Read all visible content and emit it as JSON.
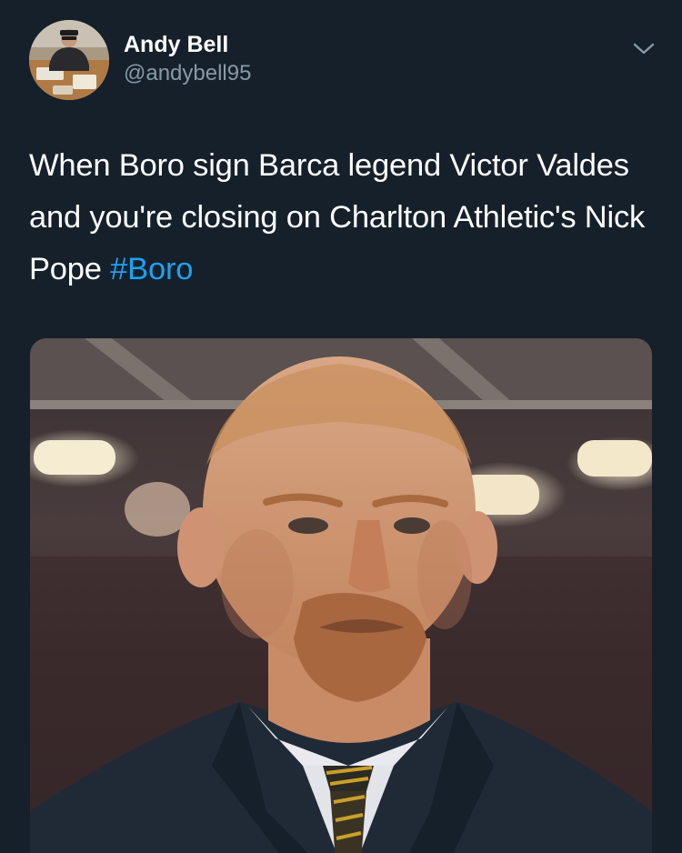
{
  "tweet": {
    "author": {
      "name": "Andy Bell",
      "handle": "@andybell95"
    },
    "text_main": "When Boro sign Barca legend Victor Valdes and you're closing on Charlton Athletic's Nick Pope",
    "hashtag": "#Boro"
  },
  "colors": {
    "background": "#15202b",
    "primary_text": "#ffffff",
    "secondary_text": "#8899a6",
    "hashtag": "#1da1f2"
  },
  "icons": {
    "menu": "chevron-down-icon"
  }
}
